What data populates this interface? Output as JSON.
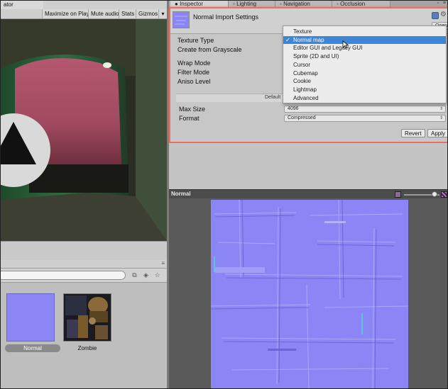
{
  "game_view": {
    "tab_label": "ator",
    "toolbar": {
      "maximize_on_play": "Maximize on Play",
      "mute_audio": "Mute audio",
      "stats": "Stats",
      "gizmos": "Gizmos"
    }
  },
  "project": {
    "search_placeholder": "",
    "toolbar_icons": [
      "scene-filter-icon",
      "label-filter-icon",
      "star-filter-icon"
    ],
    "assets": [
      {
        "label": "Normal",
        "selected": true
      },
      {
        "label": "Zombie",
        "selected": false
      }
    ]
  },
  "inspector_tabs": [
    {
      "label": "Inspector",
      "active": true
    },
    {
      "label": "Lighting",
      "active": false
    },
    {
      "label": "Navigation",
      "active": false
    },
    {
      "label": "Occlusion",
      "active": false
    }
  ],
  "inspector": {
    "title": "Normal Import Settings",
    "open_button": "Open",
    "fields": {
      "texture_type": "Texture Type",
      "create_from_grayscale": "Create from Grayscale",
      "wrap_mode": "Wrap Mode",
      "filter_mode": "Filter Mode",
      "aniso_level": "Aniso Level"
    },
    "platform_label": "Default",
    "max_size": {
      "label": "Max Size",
      "value": "4096"
    },
    "format": {
      "label": "Format",
      "value": "Compressed"
    },
    "revert_button": "Revert",
    "apply_button": "Apply",
    "highlight_color": "#e8705f"
  },
  "texture_type_menu": {
    "selected_index": 1,
    "options": [
      "Texture",
      "Normal map",
      "Editor GUI and Legacy GUI",
      "Sprite (2D and UI)",
      "Cursor",
      "Cubemap",
      "Cookie",
      "Lightmap",
      "Advanced"
    ],
    "check_mark": "✓"
  },
  "preview": {
    "title": "Normal",
    "mip_level": 0.85,
    "texture_color": "#8b85f5"
  }
}
